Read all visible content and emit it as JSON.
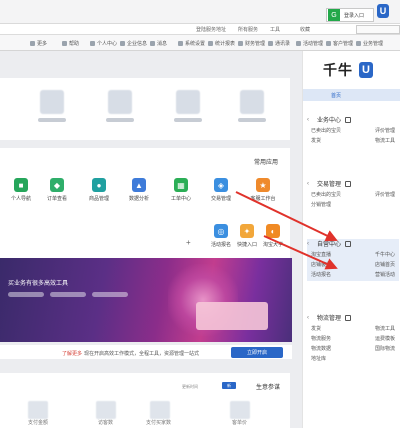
{
  "login": {
    "label": "登录入口",
    "icon_letter": "G"
  },
  "corner_logo": "U",
  "urlbar": {
    "segments": [
      "收藏",
      "工具",
      "所有服务",
      "登陆服务地址"
    ]
  },
  "bookmarks": [
    "业务管理",
    "客户管理",
    "活动管理",
    "通讯录",
    "财务管理",
    "统计报表",
    "系统设置",
    "消息",
    "企业信息",
    "个人中心",
    "帮助",
    "更多"
  ],
  "sidebar": {
    "logo_text": "千牛",
    "home": "首页",
    "sections": [
      {
        "title": "业务中心",
        "rows": [
          [
            "已卖出的宝贝",
            "评价管理"
          ],
          [
            "发货",
            "物流工具"
          ]
        ]
      },
      {
        "title": "交易管理",
        "rows": [
          [
            "已卖出的宝贝",
            "评价管理"
          ],
          [
            "分销管理",
            ""
          ]
        ]
      },
      {
        "title": "自营中心",
        "rows": [
          [
            "淘宝直播",
            "千牛中心"
          ],
          [
            "店铺装修",
            "店铺首页"
          ],
          [
            "活动报名",
            "营销活动"
          ]
        ]
      },
      {
        "title": "物流管理",
        "rows": [
          [
            "发货",
            "物流工具"
          ],
          [
            "物流服务",
            "运费模板"
          ],
          [
            "物流数据",
            "国际物流"
          ],
          [
            "地址库",
            ""
          ]
        ]
      }
    ]
  },
  "apps_title": "常用应用",
  "apps_row1": [
    "个人导航",
    "订单查看",
    "商品管理",
    "数据分析",
    "工单中心",
    "交易管理",
    "客服工作台"
  ],
  "apps_row2": [
    "活动报名",
    "快捷入口",
    "淘宝大学"
  ],
  "banner": {
    "text": "买业务有很多高效工具"
  },
  "banner_bar": {
    "text": "现在开启高效工作模式，全程工具，资源管理一站式",
    "red": "了解更多",
    "button": "立即开启"
  },
  "panel3": {
    "title": "生意参谋",
    "badge": "新",
    "meta": "更新时间",
    "tiles": [
      "支付金额",
      "访客数",
      "支付买家数",
      "客单价"
    ]
  }
}
